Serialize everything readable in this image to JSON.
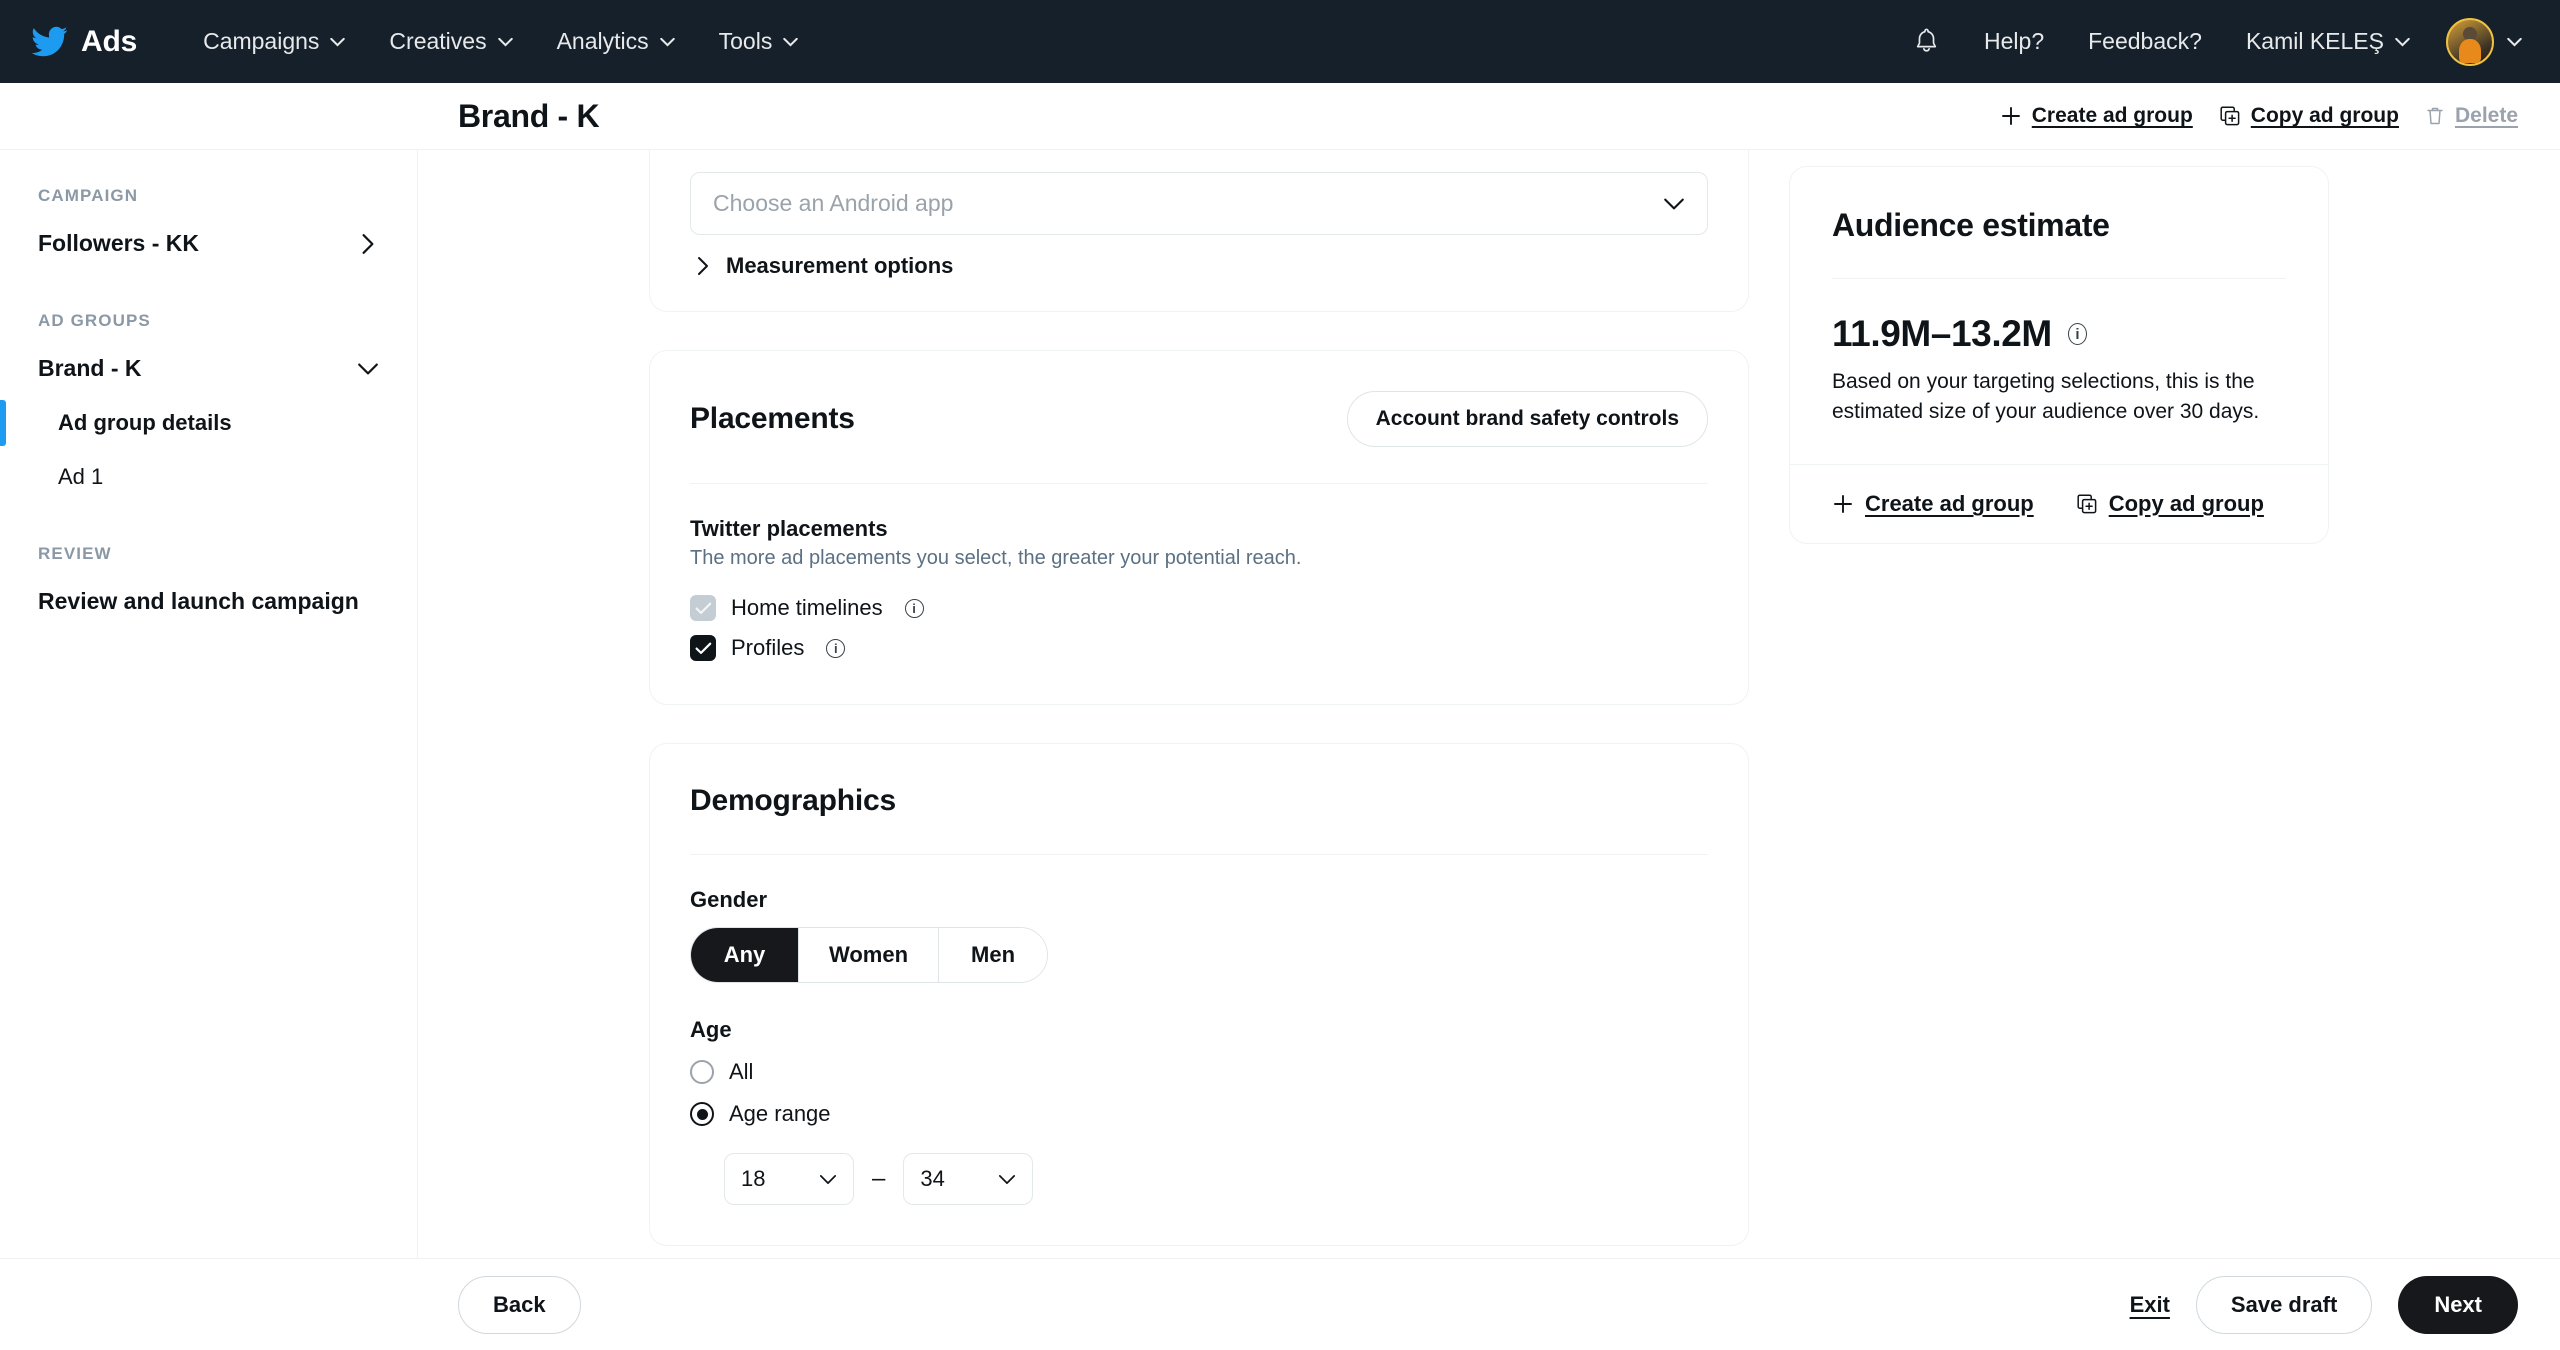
{
  "topnav": {
    "logo_icon": "twitter-bird-icon",
    "brand": "Ads",
    "items": [
      {
        "label": "Campaigns",
        "icon": "chevron-down-icon"
      },
      {
        "label": "Creatives",
        "icon": "chevron-down-icon"
      },
      {
        "label": "Analytics",
        "icon": "chevron-down-icon"
      },
      {
        "label": "Tools",
        "icon": "chevron-down-icon"
      }
    ],
    "notifications_icon": "bell-icon",
    "help": "Help?",
    "feedback": "Feedback?",
    "account": "Kamil KELEŞ",
    "account_chevron_icon": "chevron-down-icon",
    "avatar_icon": "user-avatar",
    "avatar_chevron_icon": "chevron-down-icon"
  },
  "header": {
    "title": "Brand - K",
    "actions": [
      {
        "label": "Create ad group",
        "icon": "plus-icon",
        "disabled": false
      },
      {
        "label": "Copy ad group",
        "icon": "copy-icon",
        "disabled": false
      },
      {
        "label": "Delete",
        "icon": "trash-icon",
        "disabled": true
      }
    ]
  },
  "sidebar": {
    "campaign_section": "CAMPAIGN",
    "campaign_name": "Followers - KK",
    "campaign_icon": "chevron-right-icon",
    "adgroups_section": "AD GROUPS",
    "adgroup_name": "Brand - K",
    "adgroup_icon": "chevron-down-icon",
    "subitems": [
      {
        "label": "Ad group details",
        "active": true
      },
      {
        "label": "Ad 1",
        "active": false
      }
    ],
    "review_section": "REVIEW",
    "review_label": "Review and launch campaign"
  },
  "app_card": {
    "app_select_placeholder": "Choose an Android app",
    "app_select_chevron_icon": "chevron-down-icon",
    "measurement_label": "Measurement options",
    "measurement_icon": "chevron-right-icon"
  },
  "placements": {
    "title": "Placements",
    "brand_safety_button": "Account brand safety controls",
    "group_label": "Twitter placements",
    "group_sub": "The more ad placements you select, the greater your potential reach.",
    "options": [
      {
        "label": "Home timelines",
        "checked": true,
        "disabled": true,
        "info_icon": "info-icon"
      },
      {
        "label": "Profiles",
        "checked": true,
        "disabled": false,
        "info_icon": "info-icon"
      }
    ]
  },
  "demographics": {
    "title": "Demographics",
    "gender_label": "Gender",
    "gender_options": [
      "Any",
      "Women",
      "Men"
    ],
    "gender_selected": "Any",
    "age_label": "Age",
    "age_options": [
      {
        "label": "All",
        "selected": false
      },
      {
        "label": "Age range",
        "selected": true
      }
    ],
    "age_from": "18",
    "age_to": "34",
    "age_dash": "–",
    "age_from_chevron_icon": "chevron-down-icon",
    "age_to_chevron_icon": "chevron-down-icon"
  },
  "audience": {
    "title": "Audience estimate",
    "estimate": "11.9M–13.2M",
    "estimate_info_icon": "info-icon",
    "description": "Based on your targeting selections, this is the estimated size of your audience over 30 days.",
    "links": [
      {
        "label": "Create ad group",
        "icon": "plus-icon"
      },
      {
        "label": "Copy ad group",
        "icon": "copy-icon"
      }
    ]
  },
  "footer": {
    "back": "Back",
    "exit": "Exit",
    "save_draft": "Save draft",
    "next": "Next"
  },
  "colors": {
    "nav_bg": "#15202b",
    "accent_blue": "#1d9bf0",
    "dark": "#16181c",
    "muted": "#5b7083",
    "border": "#eff3f4"
  }
}
